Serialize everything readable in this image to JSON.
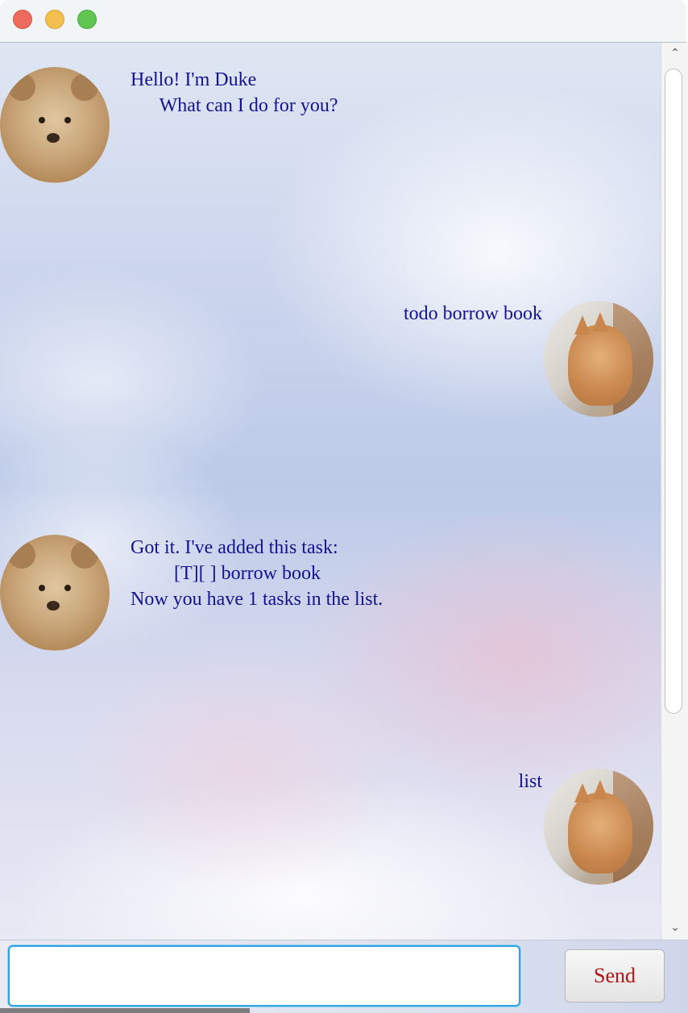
{
  "window": {
    "traffic_lights": [
      "close",
      "minimize",
      "zoom"
    ],
    "colors": {
      "close": "#ec6a5e",
      "minimize": "#f4bf4f",
      "zoom": "#61c554"
    }
  },
  "chat": {
    "background": "sky-clouds",
    "text_color": "#13138f",
    "messages": [
      {
        "sender": "duke",
        "avatar": "teddy-bear-avatar",
        "text": "Hello! I'm Duke\n      What can I do for you?"
      },
      {
        "sender": "user",
        "avatar": "corgi-avatar",
        "text": "todo borrow book"
      },
      {
        "sender": "duke",
        "avatar": "teddy-bear-avatar",
        "text": "Got it. I've added this task:\n         [T][ ] borrow book\nNow you have 1 tasks in the list."
      },
      {
        "sender": "user",
        "avatar": "corgi-avatar",
        "text": "list"
      }
    ]
  },
  "input": {
    "value": "",
    "placeholder": ""
  },
  "send_button": {
    "label": "Send",
    "color": "#b01616"
  }
}
